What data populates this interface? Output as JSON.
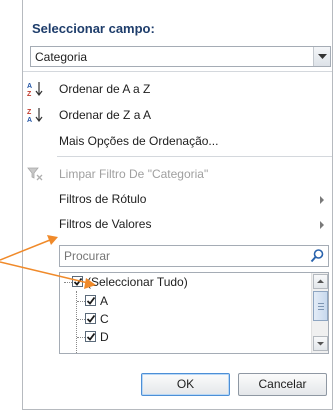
{
  "header": {
    "title": "Seleccionar campo:"
  },
  "field_select": {
    "value": "Categoria"
  },
  "menu": {
    "sort_az": "Ordenar de A a Z",
    "sort_za": "Ordenar de Z a A",
    "more_sort": "Mais Opções de Ordenação...",
    "clear_filter": "Limpar Filtro De \"Categoria\"",
    "label_filters": "Filtros de Rótulo",
    "value_filters": "Filtros de Valores"
  },
  "search": {
    "placeholder": "Procurar"
  },
  "tree": {
    "items": [
      {
        "label": "(Seleccionar Tudo)",
        "checked": true
      },
      {
        "label": "A",
        "checked": true
      },
      {
        "label": "C",
        "checked": true
      },
      {
        "label": "D",
        "checked": true
      }
    ]
  },
  "buttons": {
    "ok": "OK",
    "cancel": "Cancelar"
  },
  "colors": {
    "header_text": "#1e3d6b",
    "arrow": "#f08a2a",
    "check": "#1b1b1b",
    "ok_border": "#4d8fd6"
  },
  "icons": [
    "sort-az-icon",
    "sort-za-icon",
    "clear-filter-icon",
    "search-icon",
    "chevron-down-icon",
    "submenu-arrow-icon"
  ]
}
